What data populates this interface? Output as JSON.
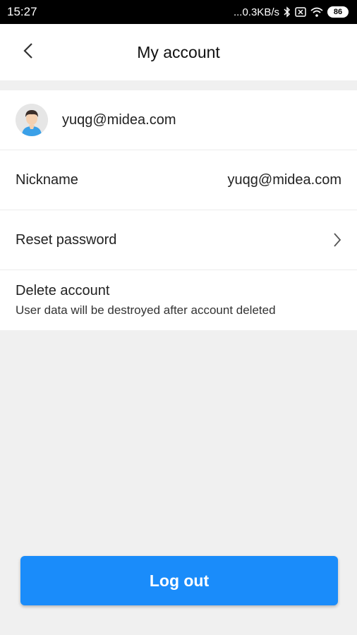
{
  "status_bar": {
    "time": "15:27",
    "network_speed": "...0.3KB/s",
    "battery_level": "86"
  },
  "header": {
    "title": "My account",
    "back_icon": "chevron-left-icon"
  },
  "profile": {
    "email": "yuqg@midea.com",
    "avatar_icon": "user-avatar-icon"
  },
  "rows": {
    "nickname": {
      "label": "Nickname",
      "value": "yuqg@midea.com"
    },
    "reset_password": {
      "label": "Reset password",
      "icon": "chevron-right-icon"
    },
    "delete_account": {
      "label": "Delete account",
      "subtitle": "User data will be destroyed after account deleted"
    }
  },
  "logout": {
    "label": "Log out"
  },
  "colors": {
    "accent": "#1a8cfa",
    "background": "#f0f0f0",
    "status_bar": "#000000"
  }
}
